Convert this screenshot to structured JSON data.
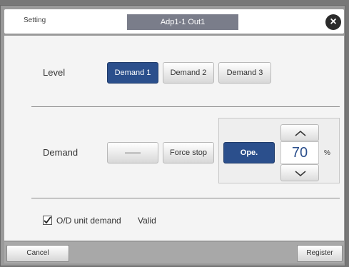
{
  "header": {
    "setting_label": "Setting",
    "title": "Adp1-1 Out1",
    "close_icon": "close-icon"
  },
  "level": {
    "label": "Level",
    "options": [
      "Demand 1",
      "Demand 2",
      "Demand 3"
    ],
    "selected": "Demand 1"
  },
  "demand": {
    "label": "Demand",
    "blank_label": "——",
    "force_stop_label": "Force stop",
    "ope_label": "Ope.",
    "value": "70",
    "unit": "%"
  },
  "od_unit": {
    "checkbox_checked": true,
    "label": "O/D unit demand",
    "status": "Valid"
  },
  "footer": {
    "cancel_label": "Cancel",
    "register_label": "Register"
  },
  "colors": {
    "active": "#2b4f8c",
    "title_bar": "#7a7d8a"
  }
}
